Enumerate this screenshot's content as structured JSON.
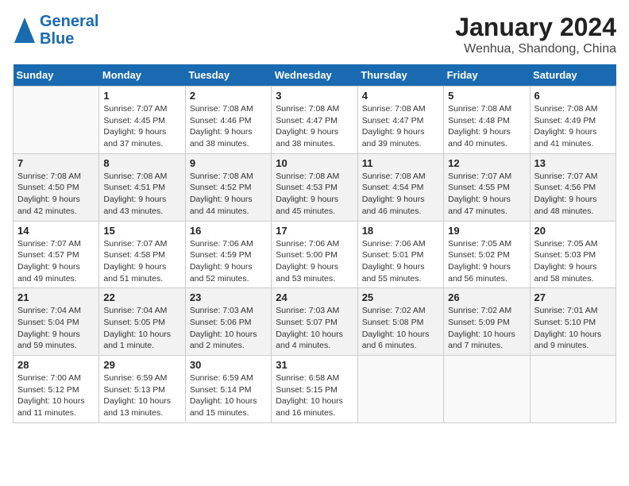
{
  "header": {
    "logo": {
      "line1": "General",
      "line2": "Blue"
    },
    "title": "January 2024",
    "subtitle": "Wenhua, Shandong, China"
  },
  "days_of_week": [
    "Sunday",
    "Monday",
    "Tuesday",
    "Wednesday",
    "Thursday",
    "Friday",
    "Saturday"
  ],
  "weeks": [
    [
      {
        "day": "",
        "info": ""
      },
      {
        "day": "1",
        "info": "Sunrise: 7:07 AM\nSunset: 4:45 PM\nDaylight: 9 hours\nand 37 minutes."
      },
      {
        "day": "2",
        "info": "Sunrise: 7:08 AM\nSunset: 4:46 PM\nDaylight: 9 hours\nand 38 minutes."
      },
      {
        "day": "3",
        "info": "Sunrise: 7:08 AM\nSunset: 4:47 PM\nDaylight: 9 hours\nand 38 minutes."
      },
      {
        "day": "4",
        "info": "Sunrise: 7:08 AM\nSunset: 4:47 PM\nDaylight: 9 hours\nand 39 minutes."
      },
      {
        "day": "5",
        "info": "Sunrise: 7:08 AM\nSunset: 4:48 PM\nDaylight: 9 hours\nand 40 minutes."
      },
      {
        "day": "6",
        "info": "Sunrise: 7:08 AM\nSunset: 4:49 PM\nDaylight: 9 hours\nand 41 minutes."
      }
    ],
    [
      {
        "day": "7",
        "info": "Sunrise: 7:08 AM\nSunset: 4:50 PM\nDaylight: 9 hours\nand 42 minutes."
      },
      {
        "day": "8",
        "info": "Sunrise: 7:08 AM\nSunset: 4:51 PM\nDaylight: 9 hours\nand 43 minutes."
      },
      {
        "day": "9",
        "info": "Sunrise: 7:08 AM\nSunset: 4:52 PM\nDaylight: 9 hours\nand 44 minutes."
      },
      {
        "day": "10",
        "info": "Sunrise: 7:08 AM\nSunset: 4:53 PM\nDaylight: 9 hours\nand 45 minutes."
      },
      {
        "day": "11",
        "info": "Sunrise: 7:08 AM\nSunset: 4:54 PM\nDaylight: 9 hours\nand 46 minutes."
      },
      {
        "day": "12",
        "info": "Sunrise: 7:07 AM\nSunset: 4:55 PM\nDaylight: 9 hours\nand 47 minutes."
      },
      {
        "day": "13",
        "info": "Sunrise: 7:07 AM\nSunset: 4:56 PM\nDaylight: 9 hours\nand 48 minutes."
      }
    ],
    [
      {
        "day": "14",
        "info": "Sunrise: 7:07 AM\nSunset: 4:57 PM\nDaylight: 9 hours\nand 49 minutes."
      },
      {
        "day": "15",
        "info": "Sunrise: 7:07 AM\nSunset: 4:58 PM\nDaylight: 9 hours\nand 51 minutes."
      },
      {
        "day": "16",
        "info": "Sunrise: 7:06 AM\nSunset: 4:59 PM\nDaylight: 9 hours\nand 52 minutes."
      },
      {
        "day": "17",
        "info": "Sunrise: 7:06 AM\nSunset: 5:00 PM\nDaylight: 9 hours\nand 53 minutes."
      },
      {
        "day": "18",
        "info": "Sunrise: 7:06 AM\nSunset: 5:01 PM\nDaylight: 9 hours\nand 55 minutes."
      },
      {
        "day": "19",
        "info": "Sunrise: 7:05 AM\nSunset: 5:02 PM\nDaylight: 9 hours\nand 56 minutes."
      },
      {
        "day": "20",
        "info": "Sunrise: 7:05 AM\nSunset: 5:03 PM\nDaylight: 9 hours\nand 58 minutes."
      }
    ],
    [
      {
        "day": "21",
        "info": "Sunrise: 7:04 AM\nSunset: 5:04 PM\nDaylight: 9 hours\nand 59 minutes."
      },
      {
        "day": "22",
        "info": "Sunrise: 7:04 AM\nSunset: 5:05 PM\nDaylight: 10 hours\nand 1 minute."
      },
      {
        "day": "23",
        "info": "Sunrise: 7:03 AM\nSunset: 5:06 PM\nDaylight: 10 hours\nand 2 minutes."
      },
      {
        "day": "24",
        "info": "Sunrise: 7:03 AM\nSunset: 5:07 PM\nDaylight: 10 hours\nand 4 minutes."
      },
      {
        "day": "25",
        "info": "Sunrise: 7:02 AM\nSunset: 5:08 PM\nDaylight: 10 hours\nand 6 minutes."
      },
      {
        "day": "26",
        "info": "Sunrise: 7:02 AM\nSunset: 5:09 PM\nDaylight: 10 hours\nand 7 minutes."
      },
      {
        "day": "27",
        "info": "Sunrise: 7:01 AM\nSunset: 5:10 PM\nDaylight: 10 hours\nand 9 minutes."
      }
    ],
    [
      {
        "day": "28",
        "info": "Sunrise: 7:00 AM\nSunset: 5:12 PM\nDaylight: 10 hours\nand 11 minutes."
      },
      {
        "day": "29",
        "info": "Sunrise: 6:59 AM\nSunset: 5:13 PM\nDaylight: 10 hours\nand 13 minutes."
      },
      {
        "day": "30",
        "info": "Sunrise: 6:59 AM\nSunset: 5:14 PM\nDaylight: 10 hours\nand 15 minutes."
      },
      {
        "day": "31",
        "info": "Sunrise: 6:58 AM\nSunset: 5:15 PM\nDaylight: 10 hours\nand 16 minutes."
      },
      {
        "day": "",
        "info": ""
      },
      {
        "day": "",
        "info": ""
      },
      {
        "day": "",
        "info": ""
      }
    ]
  ]
}
